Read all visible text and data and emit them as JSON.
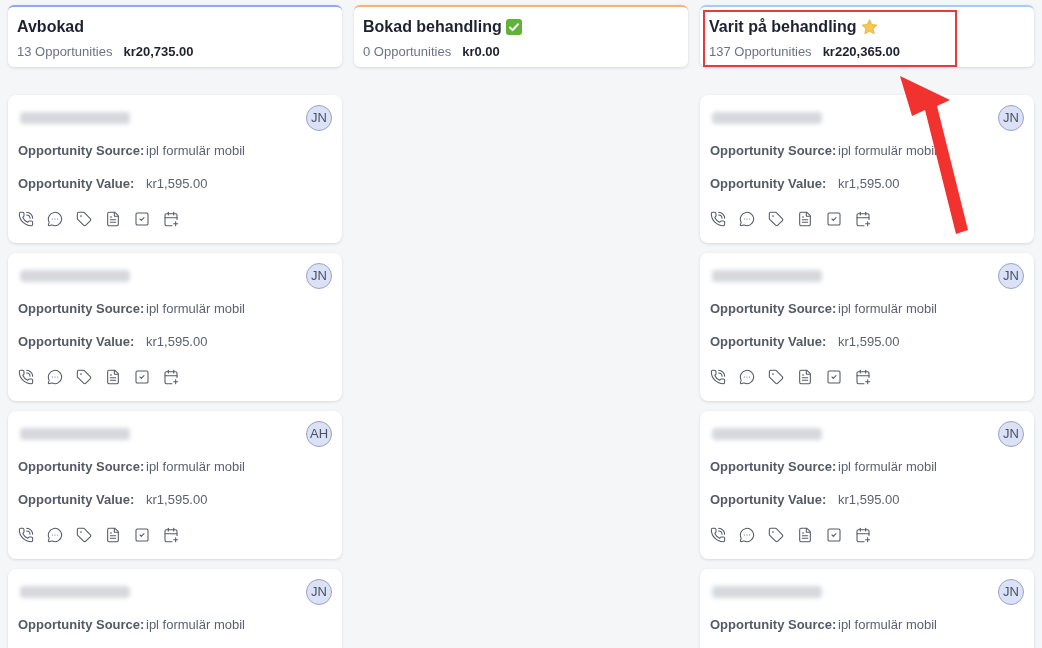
{
  "columns": [
    {
      "title": "Avbokad",
      "color": "#93a5f5",
      "count": "13 Opportunities",
      "total": "kr20,735.00",
      "highlighted": false,
      "cards": [
        {
          "avatar": "JN",
          "fields": [
            {
              "label": "Opportunity Source:",
              "value": "ipl formulär mobil"
            },
            {
              "label": "Opportunity Value:",
              "value": "kr1,595.00"
            }
          ]
        },
        {
          "avatar": "JN",
          "fields": [
            {
              "label": "Opportunity Source:",
              "value": "ipl formulär mobil"
            },
            {
              "label": "Opportunity Value:",
              "value": "kr1,595.00"
            }
          ]
        },
        {
          "avatar": "AH",
          "fields": [
            {
              "label": "Opportunity Source:",
              "value": "ipl formulär mobil"
            },
            {
              "label": "Opportunity Value:",
              "value": "kr1,595.00"
            }
          ]
        },
        {
          "avatar": "JN",
          "fields": [
            {
              "label": "Opportunity Source:",
              "value": "ipl formulär mobil"
            }
          ]
        }
      ]
    },
    {
      "title": "Bokad behandling",
      "kind": "check",
      "color": "#f5b37a",
      "count": "0 Opportunities",
      "total": "kr0.00",
      "highlighted": false
    },
    {
      "title": "Varit på behandling",
      "kind": "star",
      "color": "#a3cdf5",
      "count": "137 Opportunities",
      "total": "kr220,365.00",
      "highlighted": true,
      "cards": [
        {
          "avatar": "JN",
          "fields": [
            {
              "label": "Opportunity Source:",
              "value": "ipl formulär mobil"
            },
            {
              "label": "Opportunity Value:",
              "value": "kr1,595.00"
            }
          ]
        },
        {
          "avatar": "JN",
          "fields": [
            {
              "label": "Opportunity Source:",
              "value": "ipl formulär mobil"
            },
            {
              "label": "Opportunity Value:",
              "value": "kr1,595.00"
            }
          ]
        },
        {
          "avatar": "JN",
          "fields": [
            {
              "label": "Opportunity Source:",
              "value": "ipl formulär mobil"
            },
            {
              "label": "Opportunity Value:",
              "value": "kr1,595.00"
            }
          ]
        },
        {
          "avatar": "JN",
          "fields": [
            {
              "label": "Opportunity Source:",
              "value": "ipl formulär mobil"
            }
          ]
        }
      ]
    }
  ]
}
